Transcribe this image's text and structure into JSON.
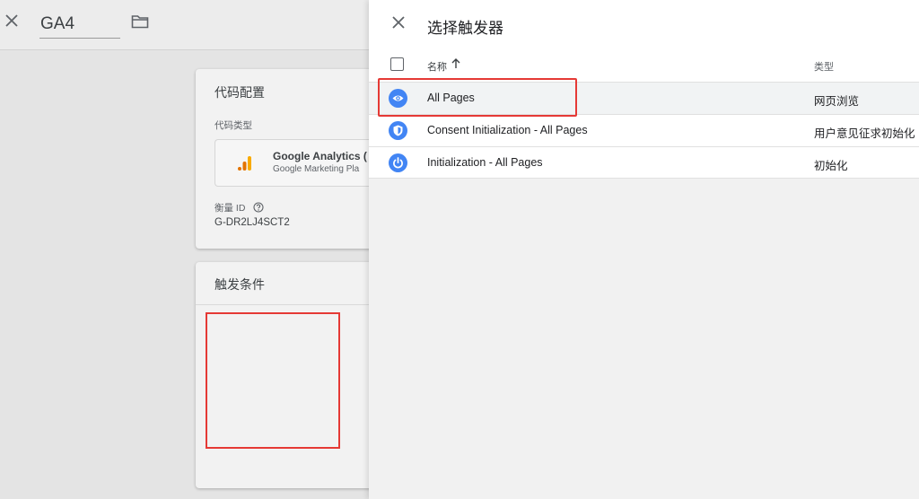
{
  "editor": {
    "title": "GA4",
    "tag_config": {
      "heading": "代码配置",
      "type_label": "代码类型",
      "type_name": "Google Analytics (",
      "type_sub": "Google Marketing Pla",
      "measure_label": "衡量 ID",
      "measure_value": "G-DR2LJ4SCT2"
    },
    "triggering": {
      "heading": "触发条件"
    }
  },
  "panel": {
    "title": "选择触发器",
    "columns": {
      "name": "名称",
      "type": "类型"
    },
    "rows": [
      {
        "name": "All Pages",
        "type": "网页浏览",
        "icon": "eye-icon"
      },
      {
        "name": "Consent Initialization - All Pages",
        "type": "用户意见征求初始化",
        "icon": "shield-icon"
      },
      {
        "name": "Initialization - All Pages",
        "type": "初始化",
        "icon": "power-icon"
      }
    ]
  },
  "colors": {
    "accent": "#4285f4",
    "highlight": "#e53935",
    "ga_orange": "#f9ab00",
    "ga_dark_orange": "#e37400"
  }
}
